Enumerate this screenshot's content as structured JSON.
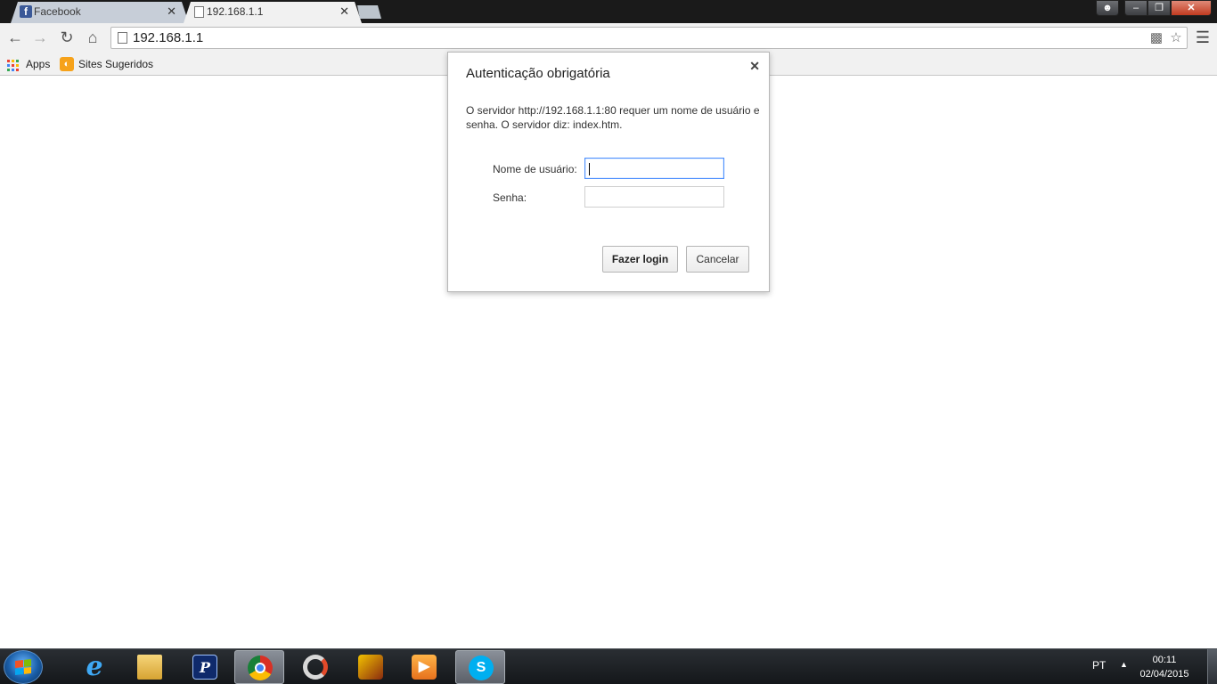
{
  "tabs": [
    {
      "title": "Facebook",
      "favicon": "facebook-icon",
      "active": false
    },
    {
      "title": "192.168.1.1",
      "favicon": "page-icon",
      "active": true
    }
  ],
  "toolbar": {
    "url": "192.168.1.1"
  },
  "bookmarks": [
    {
      "label": "Apps",
      "icon": "apps-grid-icon"
    },
    {
      "label": "Sites Sugeridos",
      "icon": "suggested-sites-icon"
    }
  ],
  "dialog": {
    "title": "Autenticação obrigatória",
    "message": "O servidor http://192.168.1.1:80 requer um nome de usuário e senha. O servidor diz: index.htm.",
    "username_label": "Nome de usuário:",
    "username_value": "",
    "password_label": "Senha:",
    "password_value": "",
    "login_button": "Fazer login",
    "cancel_button": "Cancelar"
  },
  "taskbar": {
    "apps": [
      "internet-explorer-icon",
      "file-explorer-icon",
      "photoshop-icon",
      "chrome-icon",
      "spinner-app-icon",
      "game-icon",
      "media-player-icon",
      "skype-icon"
    ],
    "active_app": "chrome-icon",
    "language": "PT",
    "time": "00:11",
    "date": "02/04/2015"
  },
  "colors": {
    "titlebar": "#1a1a1a",
    "toolbar": "#f1f1f1",
    "focus_border": "#4d90fe",
    "facebook_blue": "#3b5998"
  }
}
